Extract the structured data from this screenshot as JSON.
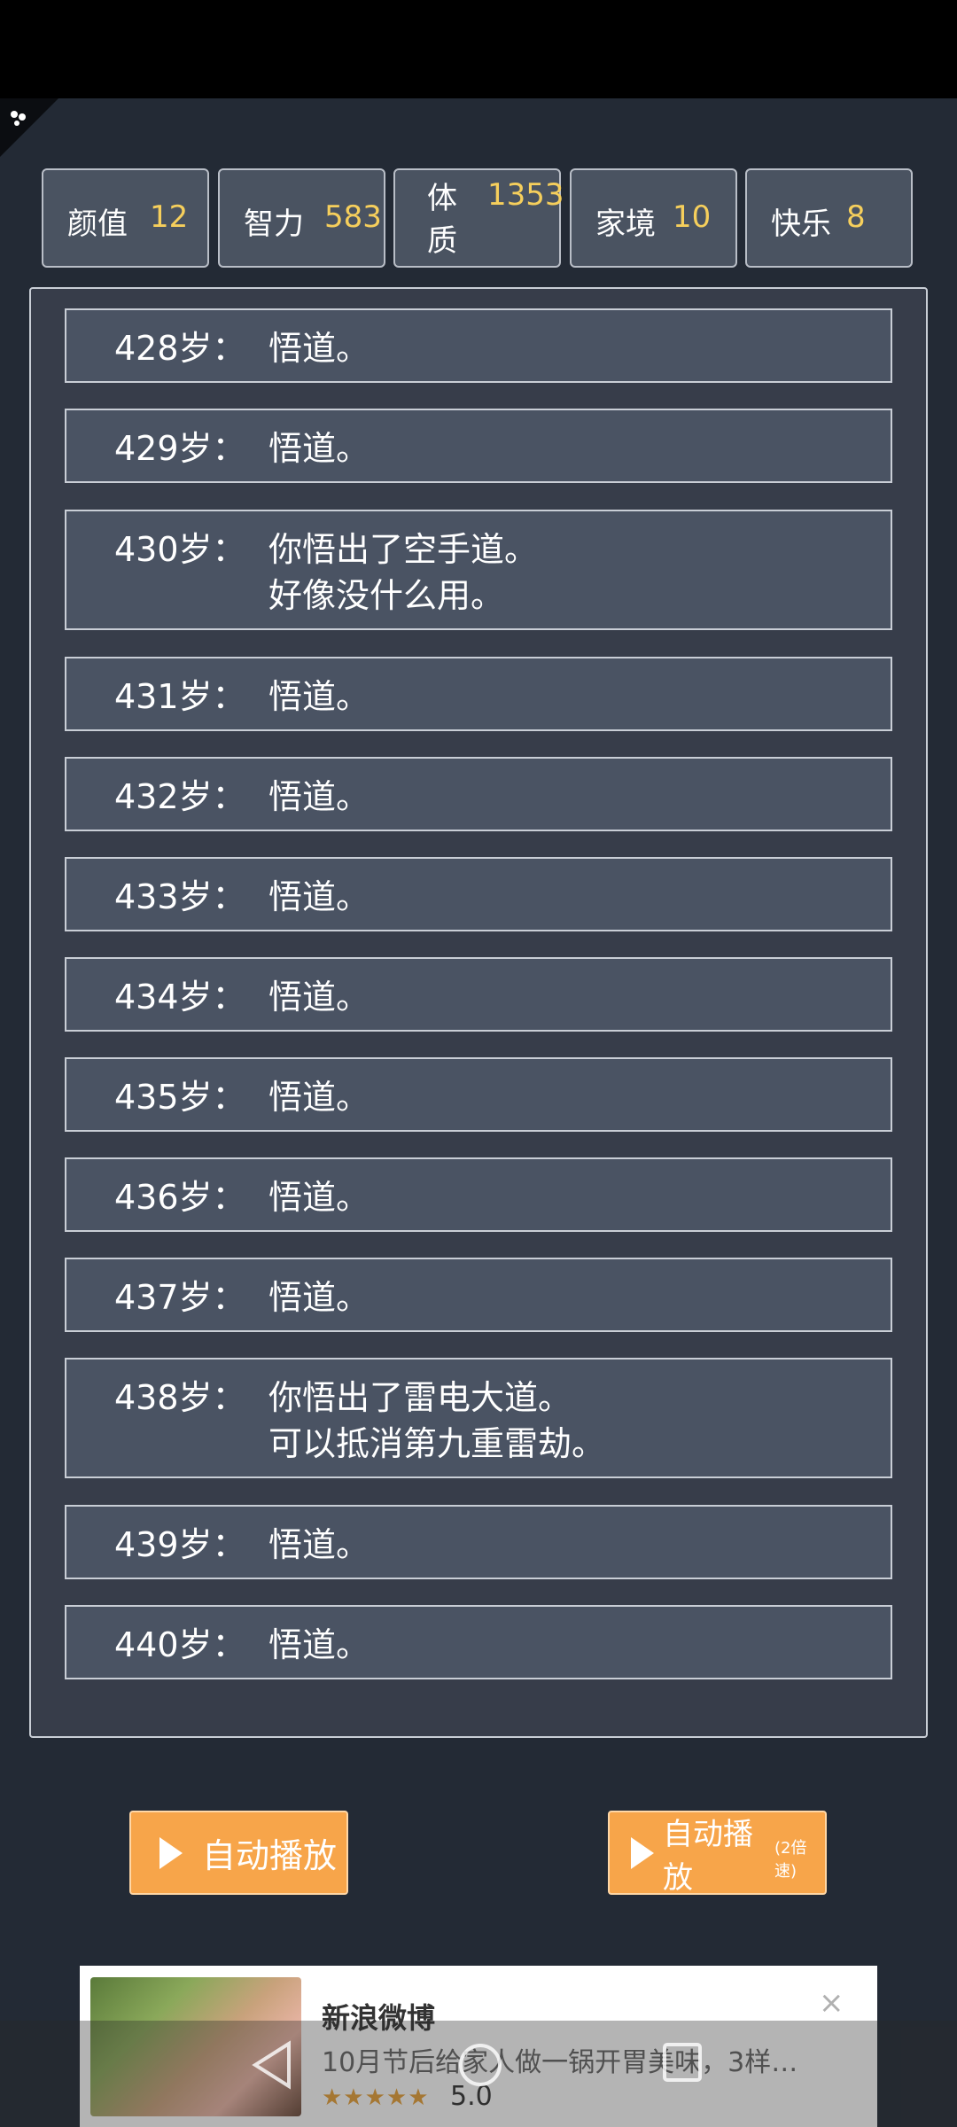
{
  "stats": [
    {
      "label": "颜值",
      "value": "12"
    },
    {
      "label": "智力",
      "value": "583"
    },
    {
      "label": "体质",
      "value": "1353"
    },
    {
      "label": "家境",
      "value": "10"
    },
    {
      "label": "快乐",
      "value": "8"
    }
  ],
  "events": [
    {
      "age": "428岁：",
      "line1": "悟道。",
      "line2": ""
    },
    {
      "age": "429岁：",
      "line1": "悟道。",
      "line2": ""
    },
    {
      "age": "430岁：",
      "line1": "你悟出了空手道。",
      "line2": "好像没什么用。"
    },
    {
      "age": "431岁：",
      "line1": "悟道。",
      "line2": ""
    },
    {
      "age": "432岁：",
      "line1": "悟道。",
      "line2": ""
    },
    {
      "age": "433岁：",
      "line1": "悟道。",
      "line2": ""
    },
    {
      "age": "434岁：",
      "line1": "悟道。",
      "line2": ""
    },
    {
      "age": "435岁：",
      "line1": "悟道。",
      "line2": ""
    },
    {
      "age": "436岁：",
      "line1": "悟道。",
      "line2": ""
    },
    {
      "age": "437岁：",
      "line1": "悟道。",
      "line2": ""
    },
    {
      "age": "438岁：",
      "line1": "你悟出了雷电大道。",
      "line2": "可以抵消第九重雷劫。"
    },
    {
      "age": "439岁：",
      "line1": "悟道。",
      "line2": ""
    },
    {
      "age": "440岁：",
      "line1": "悟道。",
      "line2": ""
    }
  ],
  "buttons": {
    "auto_play": "自动播放",
    "auto_play_fast": "自动播放",
    "auto_play_fast_sub": "(2倍速)"
  },
  "ad": {
    "title": "新浪微博",
    "desc": "10月节后给家人做一锅开胃美味，3样…",
    "stars": "★★★★★",
    "rating": "5.0",
    "close": "×"
  },
  "colors": {
    "background": "#232a35",
    "stat_value": "#f6cf5c",
    "button": "#f7a54a"
  },
  "icons": [
    "settings-corner-icon",
    "play-icon",
    "close-icon",
    "back-nav-icon",
    "home-nav-icon",
    "recents-nav-icon"
  ]
}
